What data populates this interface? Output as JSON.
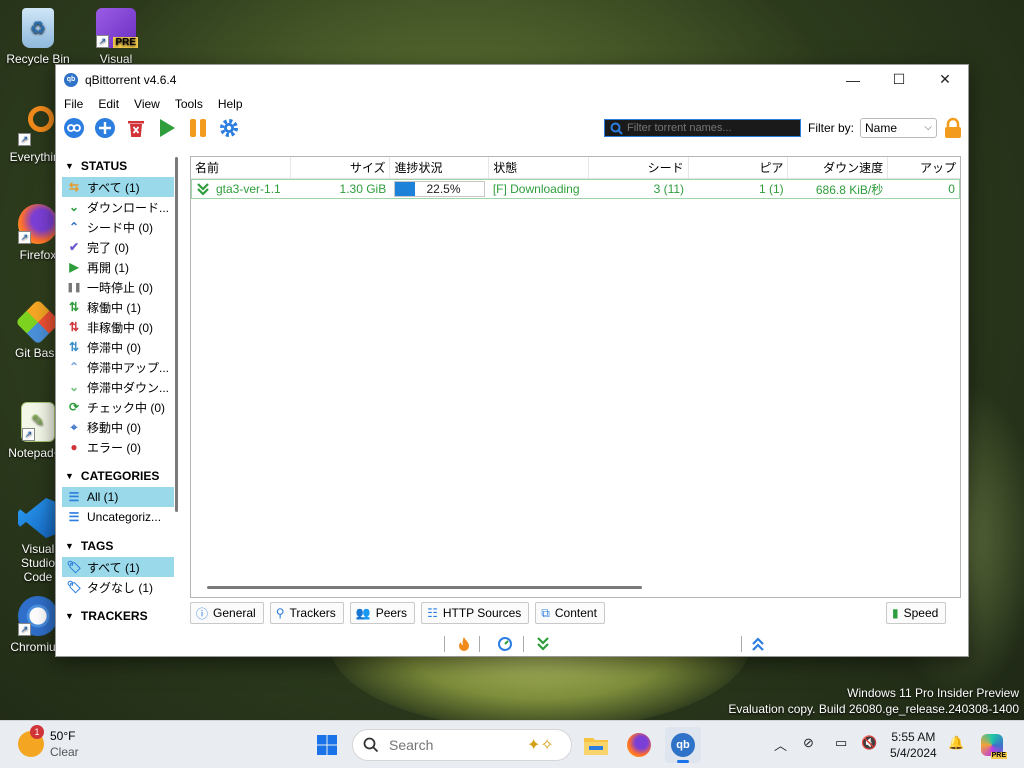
{
  "desktop": {
    "icons": [
      {
        "label": "Recycle Bin"
      },
      {
        "label": "Visual Studio"
      },
      {
        "label": "Everything"
      },
      {
        "label": "Firefox"
      },
      {
        "label": "Git Bash"
      },
      {
        "label": "Notepad++"
      },
      {
        "label": "Visual Studio Code"
      },
      {
        "label": "Chromium"
      }
    ],
    "vs_badge": "PRE",
    "watermark_line1": "Windows 11 Pro Insider Preview",
    "watermark_line2": "Evaluation copy. Build 26080.ge_release.240308-1400"
  },
  "window": {
    "title": "qBittorrent v4.6.4",
    "app_icon": "qb",
    "controls": {
      "minimize": "—",
      "maximize": "☐",
      "close": "✕"
    }
  },
  "menu": [
    "File",
    "Edit",
    "View",
    "Tools",
    "Help"
  ],
  "toolbar": {
    "search_placeholder": "Filter torrent names...",
    "filter_label": "Filter by:",
    "filter_value": "Name"
  },
  "sidebar": {
    "status_header": "STATUS",
    "status_items": [
      {
        "label": "すべて (1)",
        "icon": "all-icon",
        "color": "#e69a2b"
      },
      {
        "label": "ダウンロード...",
        "icon": "download-icon",
        "color": "#2e9e3c"
      },
      {
        "label": "シード中 (0)",
        "icon": "seed-icon",
        "color": "#3a74c9"
      },
      {
        "label": "完了 (0)",
        "icon": "check-icon",
        "color": "#6a5acd"
      },
      {
        "label": "再開 (1)",
        "icon": "play-icon",
        "color": "#2e9e3c"
      },
      {
        "label": "一時停止 (0)",
        "icon": "pause-icon",
        "color": "#777777"
      },
      {
        "label": "稼働中 (1)",
        "icon": "active-icon",
        "color": "#2e9e3c"
      },
      {
        "label": "非稼働中 (0)",
        "icon": "inactive-icon",
        "color": "#d13438"
      },
      {
        "label": "停滞中 (0)",
        "icon": "stalled-icon",
        "color": "#3a90c9"
      },
      {
        "label": "停滞中アップ...",
        "icon": "stalled-up-icon",
        "color": "#7aa7e0"
      },
      {
        "label": "停滞中ダウン...",
        "icon": "stalled-down-icon",
        "color": "#6fbf7a"
      },
      {
        "label": "チェック中 (0)",
        "icon": "checking-icon",
        "color": "#2e9e3c"
      },
      {
        "label": "移動中 (0)",
        "icon": "moving-icon",
        "color": "#3a74c9"
      },
      {
        "label": "エラー (0)",
        "icon": "error-icon",
        "color": "#d13438"
      }
    ],
    "categories_header": "CATEGORIES",
    "category_items": [
      {
        "label": "All (1)"
      },
      {
        "label": "Uncategoriz..."
      }
    ],
    "tags_header": "TAGS",
    "tag_items": [
      {
        "label": "すべて (1)"
      },
      {
        "label": "タグなし (1)"
      }
    ],
    "trackers_header": "TRACKERS"
  },
  "table": {
    "columns": [
      "名前",
      "サイズ",
      "進捗状況",
      "状態",
      "シード",
      "ピア",
      "ダウン速度",
      "アップ"
    ],
    "rows": [
      {
        "name": "gta3-ver-1.1",
        "size": "1.30 GiB",
        "progress_text": "22.5%",
        "progress": 0.225,
        "status": "[F] Downloading",
        "seeds": "3 (11)",
        "peers": "1 (1)",
        "down_speed": "686.8 KiB/秒",
        "up_speed": "0"
      }
    ]
  },
  "tabs": [
    "General",
    "Trackers",
    "Peers",
    "HTTP Sources",
    "Content"
  ],
  "speed_tab": "Speed",
  "taskbar": {
    "weather_temp": "50°F",
    "weather_desc": "Clear",
    "weather_badge": "1",
    "search_placeholder": "Search",
    "time": "5:55 AM",
    "date": "5/4/2024",
    "copilot_badge": "PRE"
  }
}
